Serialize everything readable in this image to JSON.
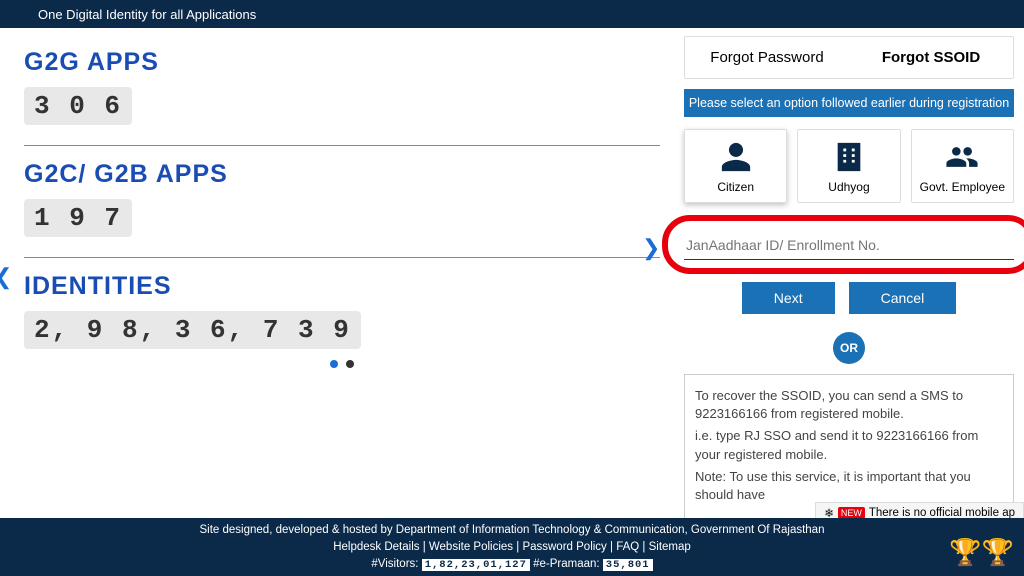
{
  "header": {
    "tagline": "One Digital Identity for all Applications"
  },
  "stats": {
    "g2g_label": "G2G APPS",
    "g2g_value": "3 0 6",
    "g2c_label": "G2C/ G2B APPS",
    "g2c_value": "1 9 7",
    "identities_label": "IDENTITIES",
    "identities_value": "2, 9 8, 3 6, 7 3 9"
  },
  "tabs": {
    "forgot_password": "Forgot Password",
    "forgot_ssoid": "Forgot SSOID"
  },
  "instruction": "Please select an option followed earlier during registration",
  "options": {
    "citizen": "Citizen",
    "udhyog": "Udhyog",
    "govt": "Govt. Employee"
  },
  "input": {
    "placeholder": "JanAadhaar ID/ Enrollment No."
  },
  "buttons": {
    "next": "Next",
    "cancel": "Cancel",
    "or": "OR"
  },
  "note": {
    "line1": "To recover the SSOID, you can send a SMS to 9223166166 from registered mobile.",
    "line2": "i.e. type RJ SSO and send it to 9223166166 from your registered mobile.",
    "line3": "Note: To use this service, it is important that you should have"
  },
  "notice": {
    "badge": "NEW",
    "text": "There is no official mobile ap",
    "flake": "❄"
  },
  "footer": {
    "line1": "Site designed, developed & hosted by Department of Information Technology & Communication, Government Of Rajasthan",
    "helpdesk": "Helpdesk Details",
    "policies": "Website Policies",
    "password": "Password Policy",
    "faq": "FAQ",
    "sitemap": "Sitemap",
    "visitors_label": "#Visitors:",
    "visitors_value": "1,82,23,01,127",
    "epramaan_label": "#e-Pramaan:",
    "epramaan_value": "35,801"
  }
}
